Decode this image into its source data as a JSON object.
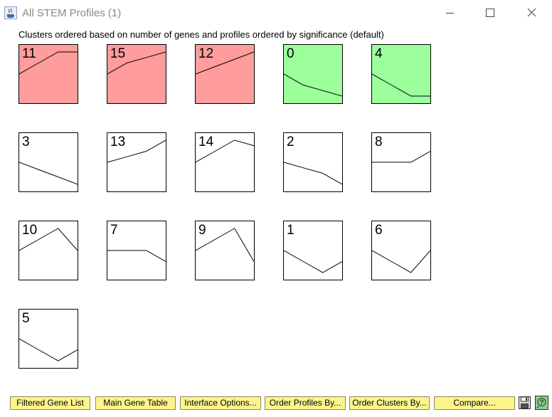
{
  "window": {
    "title": "All STEM Profiles (1)",
    "icons": [
      "java-app-icon",
      "minimize-icon",
      "maximize-icon",
      "close-icon"
    ]
  },
  "caption": "Clusters ordered based on number of genes and profiles ordered by significance (default)",
  "colors": {
    "significant_up": "#ff9c9c",
    "significant_down": "#9cff9c",
    "not_significant": "#ffffff",
    "button_bg": "#fcf58c"
  },
  "profiles": [
    {
      "id": "11",
      "color": "#ff9c9c",
      "values": [
        0,
        1,
        2,
        2
      ]
    },
    {
      "id": "15",
      "color": "#ff9c9c",
      "values": [
        0,
        1,
        1.5,
        2
      ]
    },
    {
      "id": "12",
      "color": "#ff9c9c",
      "values": [
        0,
        0.67,
        1.33,
        2
      ]
    },
    {
      "id": "0",
      "color": "#9cff9c",
      "values": [
        0,
        -1,
        -1.5,
        -2
      ]
    },
    {
      "id": "4",
      "color": "#9cff9c",
      "values": [
        0,
        -1,
        -2,
        -2
      ]
    },
    {
      "id": "3",
      "color": "#ffffff",
      "values": [
        0,
        -0.67,
        -1.33,
        -2
      ]
    },
    {
      "id": "13",
      "color": "#ffffff",
      "values": [
        0,
        0.5,
        1,
        2
      ]
    },
    {
      "id": "14",
      "color": "#ffffff",
      "values": [
        0,
        1,
        2,
        1.5
      ]
    },
    {
      "id": "2",
      "color": "#ffffff",
      "values": [
        0,
        -0.5,
        -1,
        -2
      ]
    },
    {
      "id": "8",
      "color": "#ffffff",
      "values": [
        0,
        0,
        0,
        1
      ]
    },
    {
      "id": "10",
      "color": "#ffffff",
      "values": [
        0,
        1,
        2,
        0
      ]
    },
    {
      "id": "7",
      "color": "#ffffff",
      "values": [
        0,
        0,
        0,
        -1
      ]
    },
    {
      "id": "9",
      "color": "#ffffff",
      "values": [
        0,
        1,
        2,
        -1
      ]
    },
    {
      "id": "1",
      "color": "#ffffff",
      "values": [
        0,
        -1,
        -2,
        -1
      ]
    },
    {
      "id": "6",
      "color": "#ffffff",
      "values": [
        0,
        -1,
        -2,
        0
      ]
    },
    {
      "id": "5",
      "color": "#ffffff",
      "values": [
        0,
        -1,
        -2,
        -1
      ]
    }
  ],
  "buttons": {
    "filtered_gene_list": "Filtered Gene List",
    "main_gene_table": "Main Gene Table",
    "interface_options": "Interface Options...",
    "order_profiles_by": "Order Profiles By...",
    "order_clusters_by": "Order Clusters By...",
    "compare": "Compare..."
  },
  "icon_buttons": [
    "save-icon",
    "help-icon"
  ]
}
